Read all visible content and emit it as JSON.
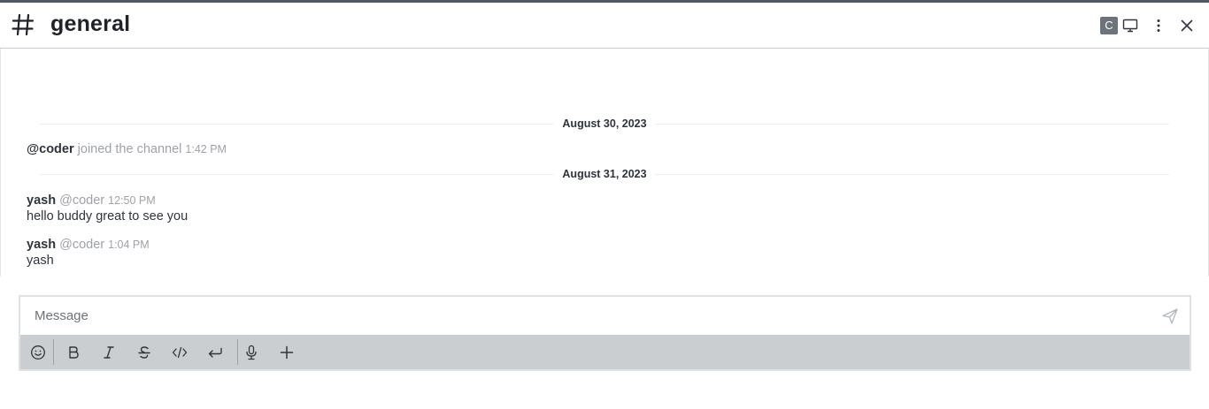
{
  "channel": {
    "name": "general"
  },
  "header": {
    "avatar_letter": "C",
    "icons": [
      "hash-icon",
      "monitor-icon",
      "kebab-menu-icon",
      "close-icon"
    ]
  },
  "messages": {
    "dividers": [
      "August 30, 2023",
      "August 31, 2023"
    ],
    "system": {
      "user": "@coder",
      "text": "joined the channel",
      "time": "1:42 PM"
    },
    "items": [
      {
        "name": "yash",
        "username": "@coder",
        "time": "12:50 PM",
        "text": "hello buddy great to see you"
      },
      {
        "name": "yash",
        "username": "@coder",
        "time": "1:04 PM",
        "text": "yash"
      }
    ]
  },
  "composer": {
    "placeholder": "Message",
    "value": "",
    "toolbar_icons": [
      "emoji-icon",
      "bold-icon",
      "italic-icon",
      "strikethrough-icon",
      "code-icon",
      "code-block-icon",
      "microphone-icon",
      "plus-icon"
    ]
  },
  "colors": {
    "toolbar_bg": "#cbced1",
    "text_primary": "#2f343d",
    "text_muted": "#9ea2a8",
    "avatar_bg": "#6c737a"
  }
}
